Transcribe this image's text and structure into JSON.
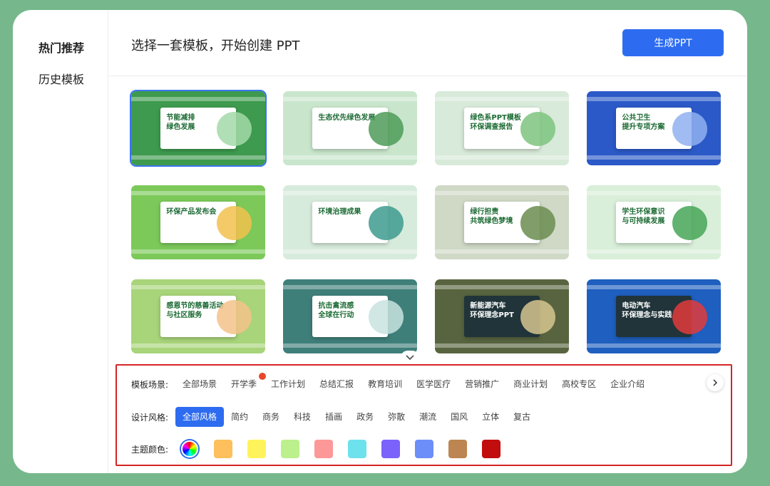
{
  "sidebar": {
    "items": [
      {
        "label": "热门推荐"
      },
      {
        "label": "历史模板"
      }
    ]
  },
  "header": {
    "title": "选择一套模板，开始创建 PPT",
    "generate_label": "生成PPT"
  },
  "templates": [
    {
      "title": "节能减排\n绿色发展",
      "bg": "#3d9a4e",
      "accent": "#a3d9a8",
      "dark": false
    },
    {
      "title": "生态优先绿色发展",
      "bg": "#c9e6cc",
      "accent": "#4d9b58",
      "dark": false
    },
    {
      "title": "绿色系PPT模板\n环保调查报告",
      "bg": "#d8ead9",
      "accent": "#7ec47f",
      "dark": false
    },
    {
      "title": "公共卫生\n提升专项方案",
      "bg": "#2b59c7",
      "accent": "#8fb0f0",
      "dark": false
    },
    {
      "title": "环保产品发布会",
      "bg": "#7cc95a",
      "accent": "#f2c14e",
      "dark": false
    },
    {
      "title": "环境治理成果",
      "bg": "#d7ebdc",
      "accent": "#3e9b8f",
      "dark": false
    },
    {
      "title": "绿行担责\n共筑绿色梦境",
      "bg": "#cfd9c6",
      "accent": "#6b8c4f",
      "dark": false
    },
    {
      "title": "学生环保意识\n与可持续发展",
      "bg": "#d9efd9",
      "accent": "#46a657",
      "dark": false
    },
    {
      "title": "感恩节的慈善活动\n与社区服务",
      "bg": "#a8d47a",
      "accent": "#f4c28a",
      "dark": false
    },
    {
      "title": "抗击禽流感\n全球在行动",
      "bg": "#3f7f7a",
      "accent": "#c8e3df",
      "dark": false
    },
    {
      "title": "新能源汽车\n环保理念PPT",
      "bg": "#58643f",
      "accent": "#d6c68f",
      "dark": true
    },
    {
      "title": "电动汽车\n环保理念与实践",
      "bg": "#1e5fbf",
      "accent": "#e33b3b",
      "dark": true
    }
  ],
  "filters": {
    "scene": {
      "label": "模板场景:",
      "options": [
        "全部场景",
        "开学季",
        "工作计划",
        "总结汇报",
        "教育培训",
        "医学医疗",
        "营销推广",
        "商业计划",
        "高校专区",
        "企业介绍"
      ]
    },
    "style": {
      "label": "设计风格:",
      "options": [
        "全部风格",
        "简约",
        "商务",
        "科技",
        "插画",
        "政务",
        "弥散",
        "潮流",
        "国风",
        "立体",
        "复古"
      ]
    },
    "color": {
      "label": "主题颜色:",
      "swatches": [
        "#fdc05d",
        "#fff35b",
        "#bcf08c",
        "#fd9898",
        "#6ee2ec",
        "#7b62fb",
        "#6b8ef9",
        "#bc8551",
        "#c10d0d"
      ]
    }
  },
  "colors": {
    "accent": "#2d6cf0",
    "highlight_border": "#d62424",
    "background": "#76b88b"
  }
}
